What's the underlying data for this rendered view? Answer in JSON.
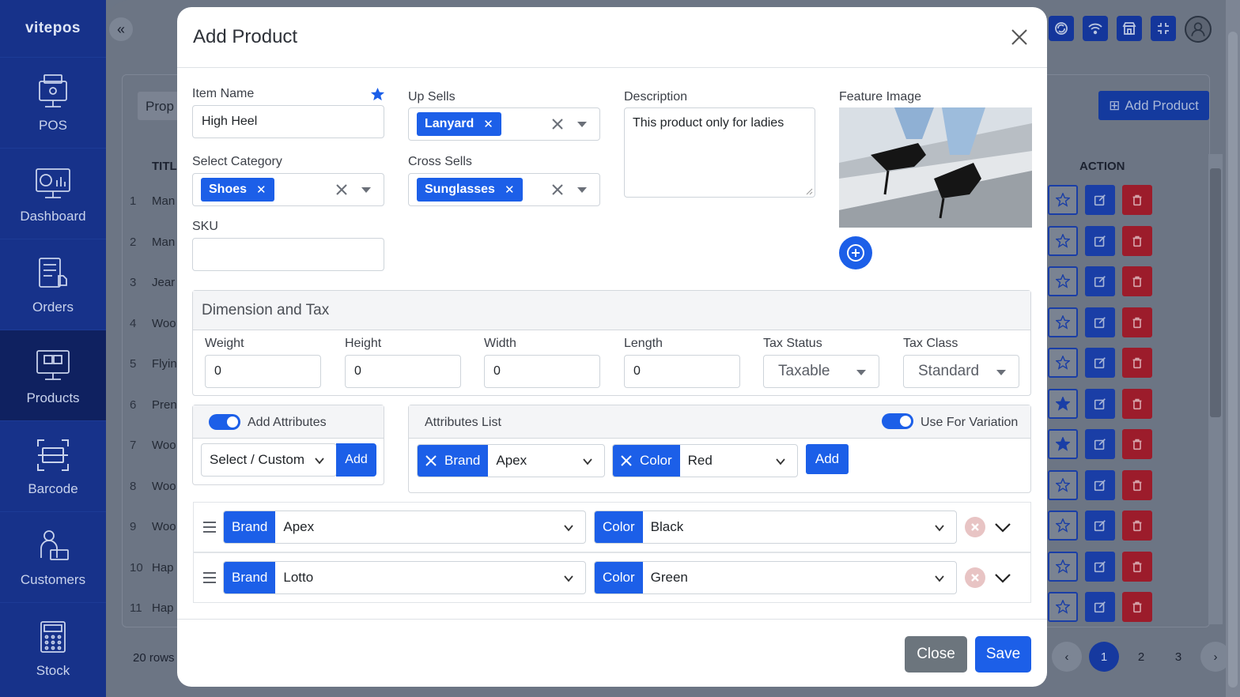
{
  "app": {
    "brand": "vitepos"
  },
  "sidebar": {
    "items": [
      {
        "label": "POS",
        "icon": "pos-terminal-icon"
      },
      {
        "label": "Dashboard",
        "icon": "dashboard-chart-icon"
      },
      {
        "label": "Orders",
        "icon": "orders-clipboard-icon"
      },
      {
        "label": "Products",
        "icon": "products-box-icon",
        "active": true
      },
      {
        "label": "Barcode",
        "icon": "barcode-scan-icon"
      },
      {
        "label": "Customers",
        "icon": "customers-user-icon"
      },
      {
        "label": "Stock",
        "icon": "stock-calculator-icon"
      }
    ]
  },
  "background": {
    "search_placeholder": "Prop",
    "add_product_label": "Add Product",
    "title_col": "TITL",
    "action_col": "ACTION",
    "rows": [
      {
        "n": "1",
        "title": "Man"
      },
      {
        "n": "2",
        "title": "Man"
      },
      {
        "n": "3",
        "title": "Jear"
      },
      {
        "n": "4",
        "title": "Woo"
      },
      {
        "n": "5",
        "title": "Flyin"
      },
      {
        "n": "6",
        "title": "Pren"
      },
      {
        "n": "7",
        "title": "Woo"
      },
      {
        "n": "8",
        "title": "Woo"
      },
      {
        "n": "9",
        "title": "Woo"
      },
      {
        "n": "10",
        "title": "Hap"
      },
      {
        "n": "11",
        "title": "Hap"
      }
    ],
    "rows_info": "20 rows",
    "pages": [
      "1",
      "2",
      "3"
    ]
  },
  "modal": {
    "title": "Add Product",
    "item_name_label": "Item Name",
    "item_name_value": "High Heel",
    "category_label": "Select Category",
    "category_chip": "Shoes",
    "sku_label": "SKU",
    "sku_value": "",
    "upsells_label": "Up Sells",
    "upsells_chip": "Lanyard",
    "crosssells_label": "Cross Sells",
    "crosssells_chip": "Sunglasses",
    "description_label": "Description",
    "description_value": "This product only for ladies",
    "feature_image_label": "Feature Image",
    "dimension": {
      "title": "Dimension and Tax",
      "weight_label": "Weight",
      "weight_value": "0",
      "height_label": "Height",
      "height_value": "0",
      "width_label": "Width",
      "width_value": "0",
      "length_label": "Length",
      "length_value": "0",
      "tax_status_label": "Tax Status",
      "tax_status_value": "Taxable",
      "tax_class_label": "Tax Class",
      "tax_class_value": "Standard"
    },
    "attributes": {
      "add_label": "Add Attributes",
      "select_placeholder": "Select / Custom",
      "add_button": "Add",
      "list_label": "Attributes List",
      "variation_label": "Use For Variation",
      "list": [
        {
          "name": "Brand",
          "value": "Apex"
        },
        {
          "name": "Color",
          "value": "Red"
        }
      ],
      "list_add_button": "Add"
    },
    "variations": [
      {
        "brand_label": "Brand",
        "brand_value": "Apex",
        "color_label": "Color",
        "color_value": "Black"
      },
      {
        "brand_label": "Brand",
        "brand_value": "Lotto",
        "color_label": "Color",
        "color_value": "Green"
      }
    ],
    "footer": {
      "close_label": "Close",
      "save_label": "Save"
    }
  },
  "colors": {
    "primary": "#1c5fe8",
    "sidebar": "#17328a",
    "danger": "#9c1c2b",
    "secondary": "#6c757d"
  }
}
